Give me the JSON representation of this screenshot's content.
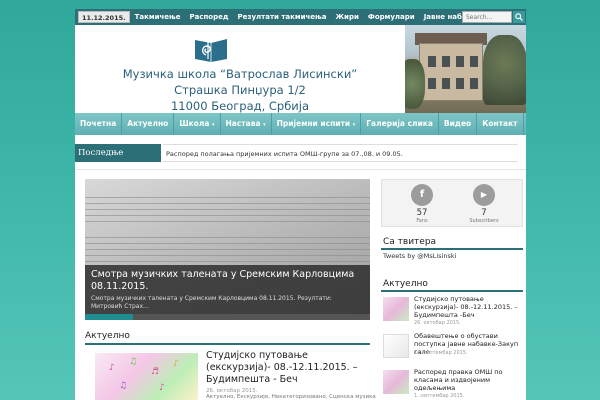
{
  "topbar": {
    "date": "11.12.2015.",
    "nav": [
      "Такмичење",
      "Распоред",
      "Резултати такмичења",
      "Жири",
      "Формулари",
      "Јавне набавке"
    ],
    "search_placeholder": "Search..."
  },
  "header": {
    "line1": "Музичка школа “Ватрослав Лисински”",
    "line2": "Страшка Пинџура 1/2",
    "line3": "11000 Београд, Србија"
  },
  "mainnav": [
    "Почетна",
    "Актуелно",
    "Школа",
    "Настава",
    "Пријемни испити",
    "Галерија слика",
    "Видео",
    "Контакт"
  ],
  "ticker": {
    "label": "Последње новости",
    "text": "Распоред полагања пријемних испита ОМШ-групе за 07.,08. и 09.05."
  },
  "slider": {
    "title": "Смотра музичких талената у Сремским Карловцима 08.11.2015.",
    "excerpt": "Смотра музичких талената у Сремским Карловцима 08.11.2015.     Резултати:   Митровић Страх..."
  },
  "main": {
    "section_title": "Актуелно",
    "post": {
      "title": "Студијско путовање (екскурзија)- 08.-12.11.2015. – Будимпешта - Беч",
      "date": "26. октобар 2015.",
      "cats": "Актуелно, Екскурзије, Некатегоризовано, Сценска музика"
    }
  },
  "sidebar": {
    "social": [
      {
        "icon": "facebook-icon",
        "glyph": "f",
        "count": "57",
        "label": "Fans"
      },
      {
        "icon": "youtube-icon",
        "glyph": "▶",
        "count": "7",
        "label": "Subscribers"
      }
    ],
    "twitter_title": "Са твитера",
    "twitter_link": "Tweets by @MsLisinski",
    "recent_title": "Актуелно",
    "recent": [
      {
        "title": "Студијско путовање (екскурзија)- 08.-12.11.2015. – Будимпешта -Беч",
        "date": "26. октобар 2015."
      },
      {
        "title": "Обавештење о обустави поступка јавне набавке-Закуп сале",
        "date": "14. септембар 2015."
      },
      {
        "title": "Распоред прaвка ОМШ по класама и издвојеним одељењима",
        "date": "1. септембар 2015."
      }
    ]
  },
  "colors": {
    "accent": "#2d6f77",
    "nav": "#5fb0b3",
    "background": "#3fb7aa"
  }
}
